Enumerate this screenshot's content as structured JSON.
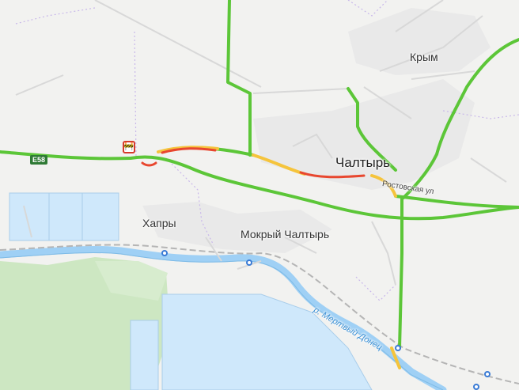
{
  "map": {
    "labels": {
      "chaltyr": "Чалтырь",
      "krym": "Крым",
      "khapry": "Хапры",
      "mokry_chaltyr": "Мокрый Чалтырь",
      "rostovskaya": "Ростовская ул",
      "river": "р. Мертвый Донец"
    },
    "route_shield": "E58",
    "incident_icon": "road-works",
    "colors": {
      "land": "#f2f2f0",
      "water": "#cfe8fb",
      "forest": "#cde7c2",
      "traffic_free": "#5cc638",
      "traffic_slow": "#f5c43c",
      "traffic_jam": "#e8472f",
      "rail": "#b0b0b0",
      "border": "#c9b8ea"
    }
  }
}
